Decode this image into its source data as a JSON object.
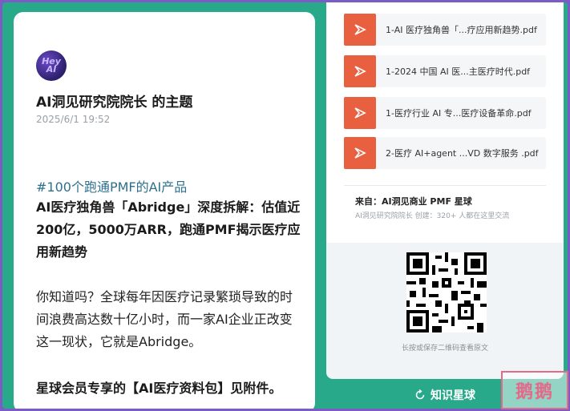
{
  "post": {
    "avatar_text": "Hey AI",
    "title": "AI洞见研究院院长 的主题",
    "time": "2025/6/1 19:52",
    "hashtag": "#100个跑通PMF的AI产品",
    "headline": "AI医疗独角兽「Abridge」深度拆解：估值近200亿，5000万ARR，跑通PMF揭示医疗应用新趋势",
    "body": "你知道吗？全球每年因医疗记录繁琐导致的时间浪费高达数十亿小时，而一家AI企业正改变这一现状，它就是Abridge。",
    "member_note": "星球会员专享的【AI医疗资料包】见附件。"
  },
  "files": [
    {
      "name": "1-AI 医疗独角兽「...疗应用新趋势.pdf"
    },
    {
      "name": "1-2024 中国 AI 医...主医疗时代.pdf"
    },
    {
      "name": "1-医疗行业 AI 专...医疗设备革命.pdf"
    },
    {
      "name": "2-医疗 AI+agent ...VD 数字服务 .pdf"
    }
  ],
  "source": {
    "from": "来自：AI洞见商业 PMF 星球",
    "sub": "AI洞见研究院院长 创建：320+ 人都在这里交流"
  },
  "qr_hint": "长按或保存二维码查看原文",
  "bottom_bar": {
    "label": "知识星球"
  },
  "watermark": "鹅鹅",
  "colors": {
    "accent": "#27a98a",
    "file_icon": "#e8603f",
    "link": "#2e6f8e"
  }
}
